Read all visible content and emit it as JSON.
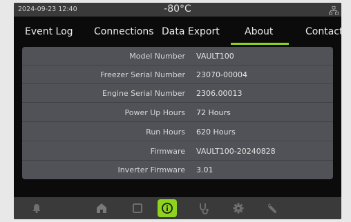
{
  "status": {
    "datetime": "2024-09-23  12:40",
    "temperature": "-80°C"
  },
  "tabs": [
    {
      "label": "Event Log"
    },
    {
      "label": "Connections"
    },
    {
      "label": "Data Export"
    },
    {
      "label": "About",
      "active": true
    },
    {
      "label": "Contact"
    }
  ],
  "about": {
    "rows": [
      {
        "label": "Model Number",
        "value": "VAULT100"
      },
      {
        "label": "Freezer Serial Number",
        "value": "23070-00004"
      },
      {
        "label": "Engine Serial Number",
        "value": "2306.00013"
      },
      {
        "label": "Power Up Hours",
        "value": "72 Hours"
      },
      {
        "label": "Run Hours",
        "value": "620 Hours"
      },
      {
        "label": "Firmware",
        "value": "VAULT100-20240828"
      },
      {
        "label": "Inverter Firmware",
        "value": "3.01"
      }
    ]
  },
  "nav": {
    "items": [
      {
        "icon": "bell-icon"
      },
      {
        "icon": "home-icon"
      },
      {
        "icon": "square-icon"
      },
      {
        "icon": "info-icon",
        "active": true
      },
      {
        "icon": "stethoscope-icon"
      },
      {
        "icon": "gear-icon"
      },
      {
        "icon": "wrench-icon"
      }
    ]
  },
  "colors": {
    "accent": "#8ed41c",
    "panel": "#505257",
    "background": "#0b0b0b",
    "bars": "#3a3a3a"
  }
}
